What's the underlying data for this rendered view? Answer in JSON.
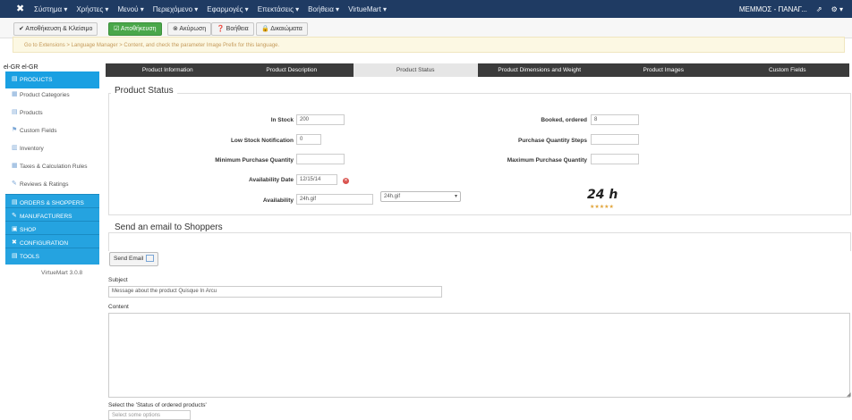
{
  "topbar": {
    "menu": [
      "Σύστημα ▾",
      "Χρήστες ▾",
      "Μενού ▾",
      "Περιεχόμενο ▾",
      "Εφαρμογές ▾",
      "Επεκτάσεις ▾",
      "Βοήθεια ▾",
      "VirtueMart ▾"
    ],
    "user": "ΜΕΜΜΟΣ - ΠΑΝΑΓ...",
    "ext_icon": "external-link-icon",
    "gear_icon": "gear-icon"
  },
  "toolbar": {
    "save_close": "✔ Αποθήκευση & Κλείσιμο",
    "save": "☑ Αποθήκευση",
    "cancel": "⊗ Ακύρωση",
    "help": "❓ Βοήθεια",
    "rights": "🔒 Δικαιώματα"
  },
  "message": "Go to Extensions > Language Manager > Content, and check the parameter Image Prefix for this language.",
  "lang_label": "el-GR el-GR",
  "sidebar": {
    "header": "PRODUCTS",
    "items": [
      {
        "label": "Product Categories"
      },
      {
        "label": "Products"
      },
      {
        "label": "Custom Fields"
      },
      {
        "label": "Inventory"
      },
      {
        "label": "Taxes & Calculation Rules"
      },
      {
        "label": "Reviews & Ratings"
      }
    ],
    "sections": [
      "ORDERS & SHOPPERS",
      "MANUFACTURERS",
      "SHOP",
      "CONFIGURATION",
      "TOOLS"
    ],
    "version": "VirtueMart 3.0.8"
  },
  "tabs": [
    "Product Information",
    "Product Description",
    "Product Status",
    "Product Dimensions and Weight",
    "Product Images",
    "Custom Fields"
  ],
  "status": {
    "legend": "Product Status",
    "in_stock_label": "In Stock",
    "in_stock_value": "200",
    "booked_label": "Booked, ordered",
    "booked_value": "8",
    "low_stock_label": "Low Stock Notification",
    "low_stock_value": "0",
    "purchase_steps_label": "Purchase Quantity Steps",
    "purchase_steps_value": "",
    "min_purchase_label": "Minimum Purchase Quantity",
    "min_purchase_value": "",
    "max_purchase_label": "Maximum Purchase Quantity",
    "max_purchase_value": "",
    "avail_date_label": "Availability Date",
    "avail_date_value": "12/15/14",
    "availability_label": "Availability",
    "availability_value": "24h.gif",
    "availability_select": "24h.gif",
    "availability_image_text": "24 h",
    "stars": "★★★★★"
  },
  "email": {
    "legend": "Send an email to Shoppers",
    "send_button": "Send Email",
    "subject_label": "Subject",
    "subject_value": "Message about the product Quisque In Arcu",
    "content_label": "Content",
    "status_label": "Select the 'Status of ordered products'",
    "status_placeholder": "Select some options"
  }
}
